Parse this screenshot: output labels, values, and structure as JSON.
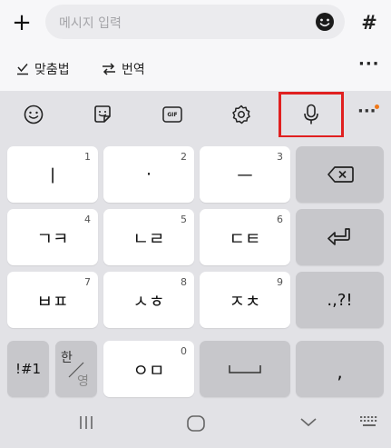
{
  "message_bar": {
    "plus_label": "+",
    "placeholder": "메시지 입력",
    "hash_label": "#"
  },
  "tools_row": {
    "spellcheck_label": "맞춤법",
    "translate_label": "번역",
    "more_label": "···"
  },
  "keyboard_toolbar": {
    "icons": [
      "emoji-icon",
      "sticker-icon",
      "gif-icon",
      "settings-icon",
      "microphone-icon",
      "more-icon"
    ],
    "gif_label": "GIF",
    "more_label": "···",
    "notification_dot_color": "#f07818",
    "highlight_color": "#e02020"
  },
  "keys": {
    "row1": [
      {
        "label": "ㅣ",
        "num": "1"
      },
      {
        "label": "·",
        "num": "2"
      },
      {
        "label": "ㅡ",
        "num": "3"
      }
    ],
    "row2": [
      {
        "label": "ㄱㅋ",
        "num": "4"
      },
      {
        "label": "ㄴㄹ",
        "num": "5"
      },
      {
        "label": "ㄷㅌ",
        "num": "6"
      }
    ],
    "row3": [
      {
        "label": "ㅂㅍ",
        "num": "7"
      },
      {
        "label": "ㅅㅎ",
        "num": "8"
      },
      {
        "label": "ㅈㅊ",
        "num": "9"
      }
    ],
    "row4": [
      {
        "label": "ㅇㅁ",
        "num": "0"
      }
    ],
    "punct_label": ".,?!",
    "symbols_label": "!#1",
    "lang_top": "한",
    "lang_bottom": "영",
    "comma_label": ","
  },
  "nav": {
    "icons": [
      "recent-apps-icon",
      "home-icon",
      "back-icon",
      "keyboard-switch-icon"
    ]
  }
}
